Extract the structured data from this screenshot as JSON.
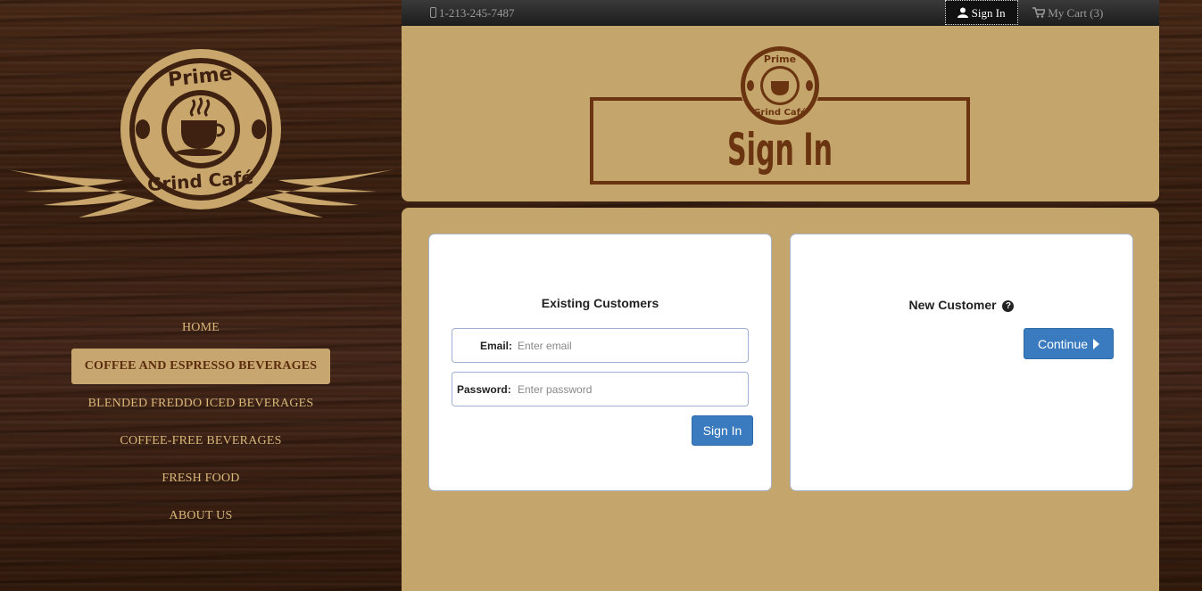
{
  "topbar": {
    "phone": "1-213-245-7487",
    "signin_label": "Sign In",
    "cart_label": "My Cart (3)"
  },
  "brand": {
    "logo_top_text": "Prime",
    "logo_bottom_text": "Grind Café",
    "page_banner": "Sign In"
  },
  "nav": {
    "items": [
      {
        "label": "HOME",
        "active": false
      },
      {
        "label": "COFFEE AND ESPRESSO BEVERAGES",
        "active": true
      },
      {
        "label": "BLENDED FREDDO ICED BEVERAGES",
        "active": false
      },
      {
        "label": "COFFEE-FREE BEVERAGES",
        "active": false
      },
      {
        "label": "FRESH FOOD",
        "active": false
      },
      {
        "label": "ABOUT US",
        "active": false
      }
    ]
  },
  "existing": {
    "title": "Existing Customers",
    "email_label": "Email:",
    "email_placeholder": "Enter email",
    "email_value": "",
    "password_label": "Password:",
    "password_placeholder": "Enter password",
    "password_value": "",
    "signin_button": "Sign In"
  },
  "new_customer": {
    "title": "New Customer",
    "continue_button": "Continue"
  },
  "colors": {
    "panel": "#c4a56c",
    "nav_text": "#d8b77a",
    "active_nav_bg": "#c7a66f",
    "brown_dark": "#5b2d0d",
    "button_blue": "#3a7bbf"
  },
  "icons": {
    "phone": "phone-icon",
    "user": "user-icon",
    "cart": "cart-icon",
    "help": "question-circle-icon",
    "continue": "caret-right-icon"
  }
}
